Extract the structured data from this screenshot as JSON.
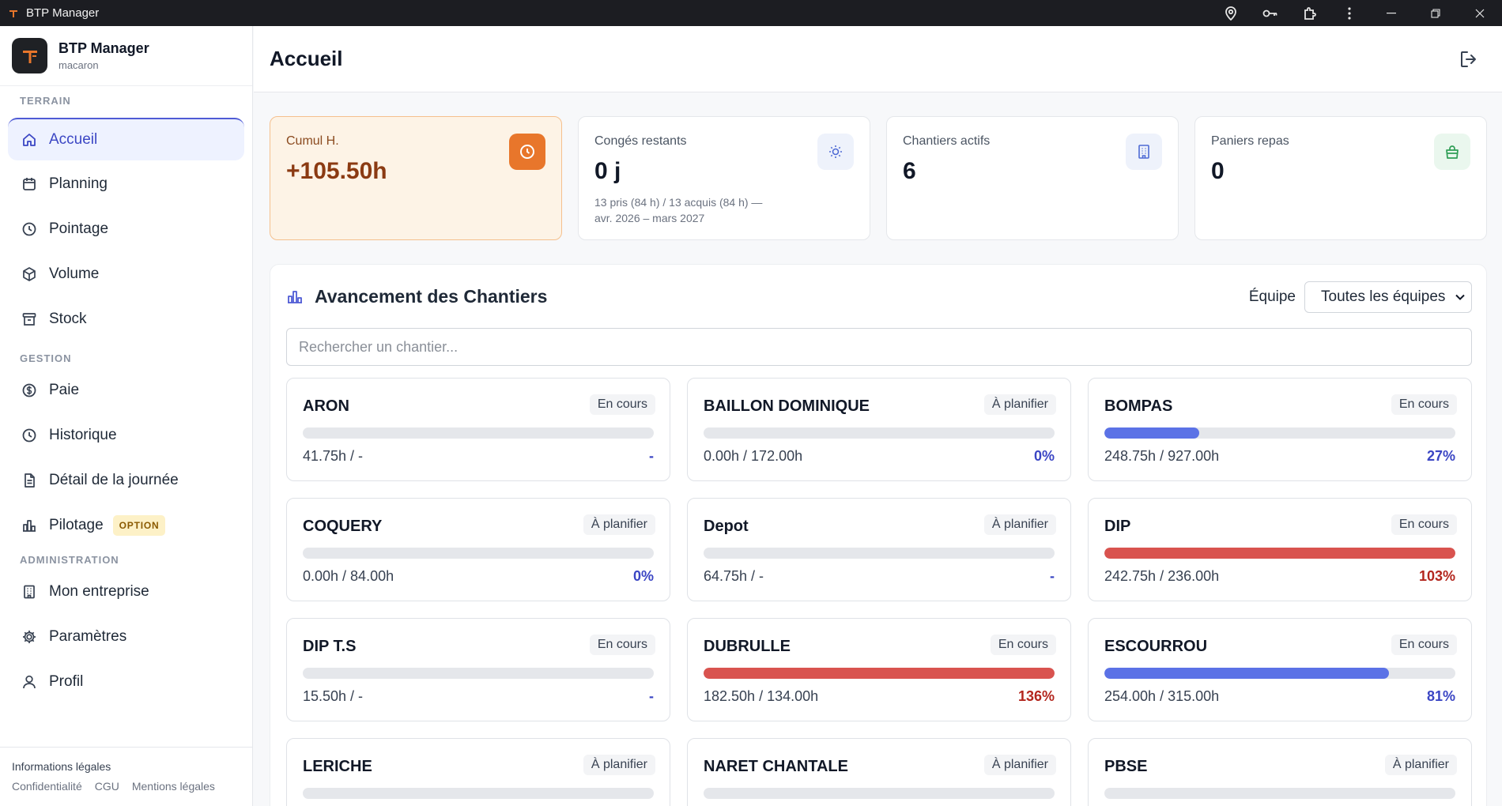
{
  "window": {
    "title": "BTP Manager"
  },
  "brand": {
    "name": "BTP Manager",
    "user": "macaron"
  },
  "nav": {
    "sections": {
      "terrain": "TERRAIN",
      "gestion": "GESTION",
      "administration": "ADMINISTRATION"
    },
    "items": [
      {
        "label": "Accueil",
        "icon": "home-icon",
        "active": true
      },
      {
        "label": "Planning",
        "icon": "calendar-icon"
      },
      {
        "label": "Pointage",
        "icon": "clock-icon"
      },
      {
        "label": "Volume",
        "icon": "box-icon"
      },
      {
        "label": "Stock",
        "icon": "archive-icon"
      },
      {
        "label": "Paie",
        "icon": "dollar-icon"
      },
      {
        "label": "Historique",
        "icon": "history-icon"
      },
      {
        "label": "Détail de la journée",
        "icon": "document-icon"
      },
      {
        "label": "Pilotage",
        "icon": "bar-chart-icon",
        "badge": "OPTION"
      },
      {
        "label": "Mon entreprise",
        "icon": "building-icon"
      },
      {
        "label": "Paramètres",
        "icon": "gear-icon"
      },
      {
        "label": "Profil",
        "icon": "user-icon"
      }
    ]
  },
  "footer": {
    "title": "Informations légales",
    "links": [
      "Confidentialité",
      "CGU",
      "Mentions légales"
    ]
  },
  "header": {
    "title": "Accueil"
  },
  "stats": [
    {
      "label": "Cumul H.",
      "value": "+105.50h",
      "icon": "clock-icon",
      "highlight": true
    },
    {
      "label": "Congés restants",
      "value": "0 j",
      "note_line1": "13 pris (84 h) / 13 acquis (84 h) —",
      "note_line2": "avr. 2026 – mars 2027",
      "icon": "sun-icon"
    },
    {
      "label": "Chantiers actifs",
      "value": "6",
      "icon": "building-icon"
    },
    {
      "label": "Paniers repas",
      "value": "0",
      "icon": "bag-icon"
    }
  ],
  "panel": {
    "title": "Avancement des Chantiers",
    "filter_label": "Équipe",
    "filter_value": "Toutes les équipes",
    "search_placeholder": "Rechercher un chantier..."
  },
  "sites": [
    {
      "name": "ARON",
      "status": "En cours",
      "hours": "41.75h / -",
      "pct": "-",
      "progress": 0,
      "tone": "blue"
    },
    {
      "name": "BAILLON DOMINIQUE",
      "status": "À planifier",
      "hours": "0.00h / 172.00h",
      "pct": "0%",
      "progress": 0,
      "tone": "blue"
    },
    {
      "name": "BOMPAS",
      "status": "En cours",
      "hours": "248.75h / 927.00h",
      "pct": "27%",
      "progress": 27,
      "tone": "blue"
    },
    {
      "name": "COQUERY",
      "status": "À planifier",
      "hours": "0.00h / 84.00h",
      "pct": "0%",
      "progress": 0,
      "tone": "blue"
    },
    {
      "name": "Depot",
      "status": "À planifier",
      "hours": "64.75h / -",
      "pct": "-",
      "progress": 0,
      "tone": "blue"
    },
    {
      "name": "DIP",
      "status": "En cours",
      "hours": "242.75h / 236.00h",
      "pct": "103%",
      "progress": 100,
      "tone": "red"
    },
    {
      "name": "DIP T.S",
      "status": "En cours",
      "hours": "15.50h / -",
      "pct": "-",
      "progress": 0,
      "tone": "blue"
    },
    {
      "name": "DUBRULLE",
      "status": "En cours",
      "hours": "182.50h / 134.00h",
      "pct": "136%",
      "progress": 100,
      "tone": "red"
    },
    {
      "name": "ESCOURROU",
      "status": "En cours",
      "hours": "254.00h / 315.00h",
      "pct": "81%",
      "progress": 81,
      "tone": "blue"
    },
    {
      "name": "LERICHE",
      "status": "À planifier",
      "hours": "",
      "pct": "",
      "progress": 0,
      "tone": "blue"
    },
    {
      "name": "NARET CHANTALE",
      "status": "À planifier",
      "hours": "",
      "pct": "",
      "progress": 0,
      "tone": "blue"
    },
    {
      "name": "PBSE",
      "status": "À planifier",
      "hours": "",
      "pct": "",
      "progress": 0,
      "tone": "blue"
    }
  ],
  "colors": {
    "accent": "#4f5bd5",
    "progress_blue": "#5b72e6",
    "progress_red": "#d9534f",
    "pct_blue": "#3b46c4",
    "pct_red": "#b3261e",
    "orange": "#e8762b"
  }
}
